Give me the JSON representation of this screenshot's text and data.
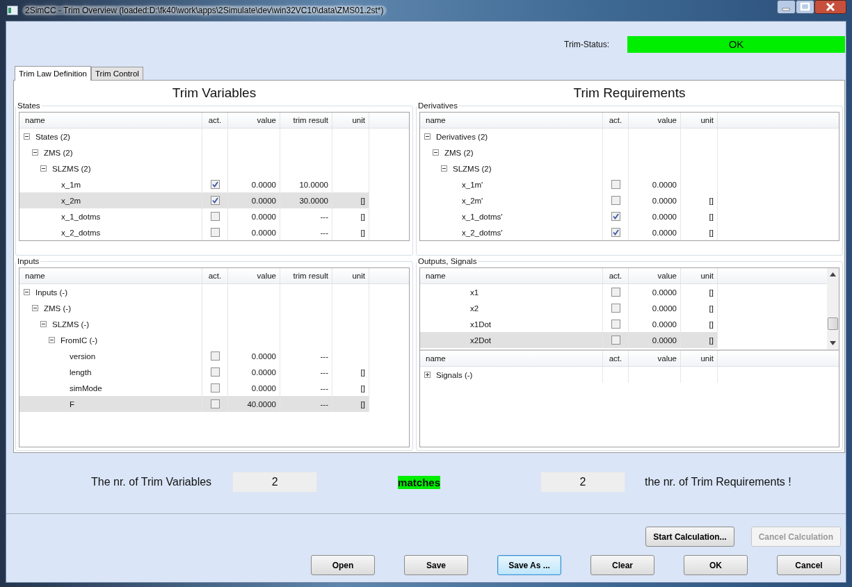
{
  "window": {
    "title": "2SimCC - Trim Overview (loaded:D:\\fk40\\work\\apps\\2Simulate\\dev\\win32VC10\\data\\ZMS01.2st*)"
  },
  "trim_status": {
    "label": "Trim-Status:",
    "value": "OK",
    "ok": true
  },
  "tabs": [
    {
      "label": "Trim Law Definition",
      "selected": true
    },
    {
      "label": "Trim Control",
      "selected": false
    }
  ],
  "sides": [
    {
      "title": "Trim Variables",
      "panels": [
        {
          "title": "States",
          "tables": [
            {
              "scrollbar": false,
              "columns": [
                {
                  "label": "name",
                  "kind": "name"
                },
                {
                  "label": "act.",
                  "kind": "active"
                },
                {
                  "label": "value",
                  "kind": "value"
                },
                {
                  "label": "trim result",
                  "kind": "trim_result"
                },
                {
                  "label": "unit",
                  "kind": "unit"
                }
              ],
              "tree": [
                {
                  "name": "States (2)",
                  "expanded": true,
                  "children": [
                    {
                      "name": "ZMS (2)",
                      "expanded": true,
                      "children": [
                        {
                          "name": "SLZMS (2)",
                          "expanded": true,
                          "children": [
                            {
                              "name": "x_1m",
                              "checked": true,
                              "value": "0.0000",
                              "trim_result": "10.0000",
                              "selected": false
                            },
                            {
                              "name": "x_2m",
                              "checked": true,
                              "value": "0.0000",
                              "trim_result": "30.0000",
                              "unit": "[]",
                              "selected": true
                            },
                            {
                              "name": "x_1_dotms",
                              "checked": false,
                              "value": "0.0000",
                              "trim_result": "---",
                              "unit": "[]",
                              "selected": false
                            },
                            {
                              "name": "x_2_dotms",
                              "checked": false,
                              "value": "0.0000",
                              "trim_result": "---",
                              "unit": "[]",
                              "selected": false
                            }
                          ]
                        }
                      ]
                    }
                  ]
                }
              ]
            }
          ]
        },
        {
          "title": "Inputs",
          "tables": [
            {
              "scrollbar": false,
              "columns": [
                {
                  "label": "name",
                  "kind": "name"
                },
                {
                  "label": "act.",
                  "kind": "active"
                },
                {
                  "label": "value",
                  "kind": "value"
                },
                {
                  "label": "trim result",
                  "kind": "trim_result"
                },
                {
                  "label": "unit",
                  "kind": "unit"
                }
              ],
              "tree": [
                {
                  "name": "Inputs (-)",
                  "expanded": true,
                  "children": [
                    {
                      "name": "ZMS (-)",
                      "expanded": true,
                      "children": [
                        {
                          "name": "SLZMS (-)",
                          "expanded": true,
                          "children": [
                            {
                              "name": "FromIC (-)",
                              "expanded": true,
                              "children": [
                                {
                                  "name": "version",
                                  "checked": false,
                                  "value": "0.0000",
                                  "trim_result": "---",
                                  "selected": false
                                },
                                {
                                  "name": "length",
                                  "checked": false,
                                  "value": "0.0000",
                                  "trim_result": "---",
                                  "unit": "[]",
                                  "selected": false
                                },
                                {
                                  "name": "simMode",
                                  "checked": false,
                                  "value": "0.0000",
                                  "trim_result": "---",
                                  "unit": "[]",
                                  "selected": false
                                },
                                {
                                  "name": "F",
                                  "checked": false,
                                  "value": "40.0000",
                                  "trim_result": "---",
                                  "unit": "[]",
                                  "selected": true
                                }
                              ]
                            }
                          ]
                        }
                      ]
                    }
                  ]
                }
              ]
            }
          ]
        }
      ]
    },
    {
      "title": "Trim Requirements",
      "panels": [
        {
          "title": "Derivatives",
          "tables": [
            {
              "scrollbar": false,
              "columns": [
                {
                  "label": "name",
                  "kind": "name"
                },
                {
                  "label": "act.",
                  "kind": "active"
                },
                {
                  "label": "value",
                  "kind": "value"
                },
                {
                  "label": "unit",
                  "kind": "unit"
                }
              ],
              "tree": [
                {
                  "name": "Derivatives (2)",
                  "expanded": true,
                  "children": [
                    {
                      "name": "ZMS (2)",
                      "expanded": true,
                      "children": [
                        {
                          "name": "SLZMS (2)",
                          "expanded": true,
                          "children": [
                            {
                              "name": "x_1m'",
                              "checked": false,
                              "value": "0.0000",
                              "selected": false
                            },
                            {
                              "name": "x_2m'",
                              "checked": false,
                              "value": "0.0000",
                              "unit": "[]",
                              "selected": false
                            },
                            {
                              "name": "x_1_dotms'",
                              "checked": true,
                              "value": "0.0000",
                              "unit": "[]",
                              "selected": false
                            },
                            {
                              "name": "x_2_dotms'",
                              "checked": true,
                              "value": "0.0000",
                              "unit": "[]",
                              "selected": false
                            }
                          ]
                        }
                      ]
                    }
                  ]
                }
              ]
            }
          ]
        },
        {
          "title": "Outputs, Signals",
          "tables": [
            {
              "scrollbar": true,
              "columns": [
                {
                  "label": "name",
                  "kind": "name"
                },
                {
                  "label": "act.",
                  "kind": "active"
                },
                {
                  "label": "value",
                  "kind": "value"
                },
                {
                  "label": "unit",
                  "kind": "unit"
                }
              ],
              "tree": [
                {
                  "name": "x1",
                  "checked": false,
                  "value": "0.0000",
                  "unit": "[]",
                  "selected": false
                },
                {
                  "name": "x2",
                  "checked": false,
                  "value": "0.0000",
                  "unit": "[]",
                  "selected": false
                },
                {
                  "name": "x1Dot",
                  "checked": false,
                  "value": "0.0000",
                  "unit": "[]",
                  "selected": false
                },
                {
                  "name": "x2Dot",
                  "checked": false,
                  "value": "0.0000",
                  "unit": "[]",
                  "selected": true
                }
              ]
            },
            {
              "scrollbar": false,
              "columns": [
                {
                  "label": "name",
                  "kind": "name"
                },
                {
                  "label": "act.",
                  "kind": "active"
                },
                {
                  "label": "value",
                  "kind": "value"
                },
                {
                  "label": "unit",
                  "kind": "unit"
                }
              ],
              "tree": [
                {
                  "name": "Signals (-)",
                  "expanded": false
                }
              ]
            }
          ]
        }
      ]
    }
  ],
  "summary": {
    "left_label": "The nr. of Trim Variables",
    "left_count": "2",
    "verdict": "matches",
    "match": true,
    "right_count": "2",
    "right_label": "the nr. of Trim Requirements !"
  },
  "calc_buttons": [
    {
      "label": "Start Calculation...",
      "disabled": false,
      "focused": false
    },
    {
      "label": "Cancel Calculation",
      "disabled": true,
      "focused": false
    }
  ],
  "buttons": [
    {
      "label": "Open",
      "disabled": false,
      "focused": false
    },
    {
      "label": "Save",
      "disabled": false,
      "focused": false
    },
    {
      "label": "Save As ...",
      "disabled": false,
      "focused": true
    },
    {
      "label": "Clear",
      "disabled": false,
      "focused": false
    },
    {
      "label": "OK",
      "disabled": false,
      "focused": false
    },
    {
      "label": "Cancel",
      "disabled": false,
      "focused": false
    }
  ]
}
